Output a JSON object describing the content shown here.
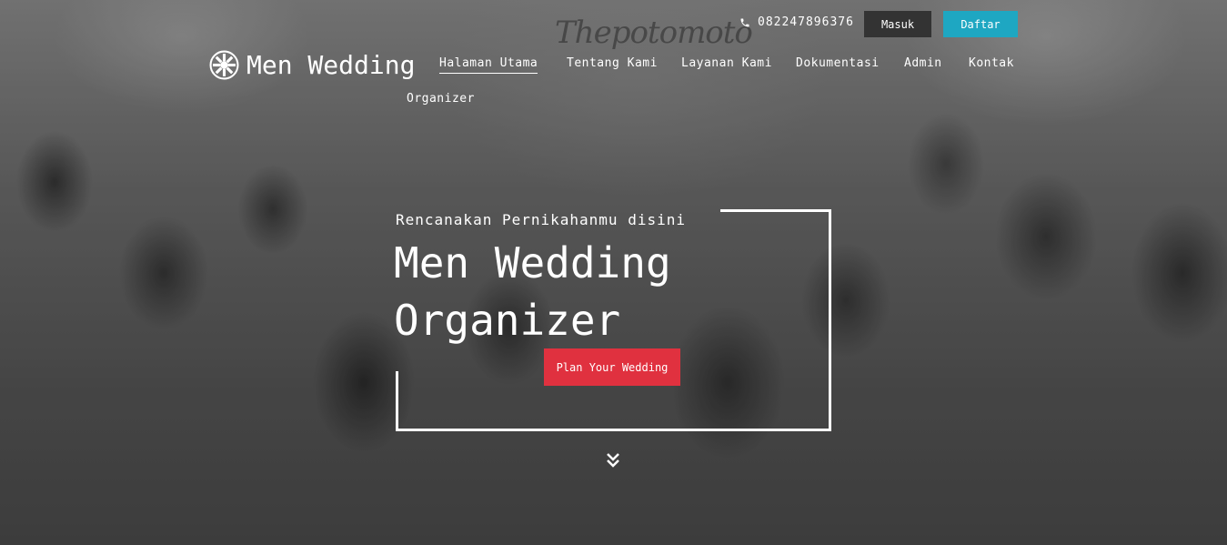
{
  "watermark": "Thepotomoto",
  "topbar": {
    "phone": "082247896376",
    "login_label": "Masuk",
    "register_label": "Daftar"
  },
  "brand": {
    "name": "Men Wedding",
    "sub": "Organizer"
  },
  "nav": {
    "items": [
      {
        "label": "Halaman Utama",
        "active": true
      },
      {
        "label": "Tentang Kami"
      },
      {
        "label": "Layanan Kami"
      },
      {
        "label": "Dokumentasi"
      },
      {
        "label": "Admin"
      },
      {
        "label": "Kontak"
      }
    ]
  },
  "hero": {
    "subtitle": "Rencanakan Pernikahanmu disini",
    "title_line1": "Men Wedding",
    "title_line2": "Organizer",
    "cta_label": "Plan Your Wedding"
  },
  "colors": {
    "accent_red": "#e0313f",
    "accent_blue": "#1ea7c2",
    "dark_button": "#333333"
  }
}
